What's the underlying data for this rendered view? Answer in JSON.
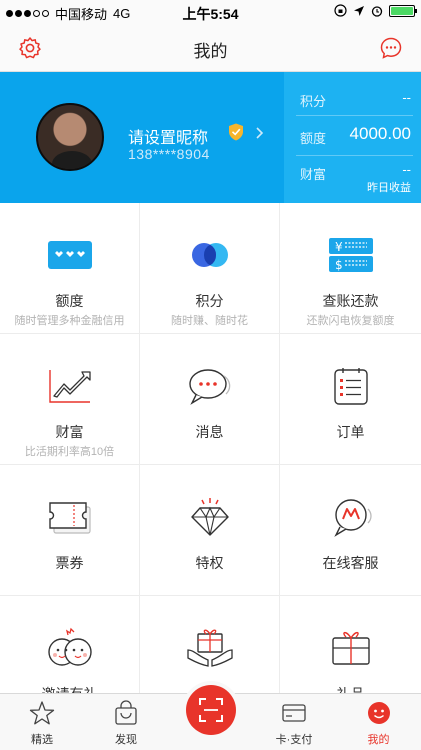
{
  "status_bar": {
    "carrier": "中国移动",
    "network": "4G",
    "time": "上午5:54"
  },
  "nav": {
    "title": "我的"
  },
  "profile": {
    "nickname": "请设置昵称",
    "phone": "138****8904",
    "stats": [
      {
        "label": "积分",
        "value": "--"
      },
      {
        "label": "额度",
        "value": "4000.00"
      },
      {
        "label": "财富",
        "value": "--"
      }
    ],
    "wealth_sub": "昨日收益"
  },
  "grid": [
    {
      "title": "额度",
      "subtitle": "随时管理多种金融信用",
      "icon": "credit-card-icon"
    },
    {
      "title": "积分",
      "subtitle": "随时赚、随时花",
      "icon": "points-icon"
    },
    {
      "title": "查账还款",
      "subtitle": "还款闪电恢复额度",
      "icon": "bill-icon"
    },
    {
      "title": "财富",
      "subtitle": "比活期利率高10倍",
      "icon": "wealth-chart-icon"
    },
    {
      "title": "消息",
      "subtitle": "",
      "icon": "message-icon"
    },
    {
      "title": "订单",
      "subtitle": "",
      "icon": "order-icon"
    },
    {
      "title": "票券",
      "subtitle": "",
      "icon": "ticket-icon"
    },
    {
      "title": "特权",
      "subtitle": "",
      "icon": "diamond-icon"
    },
    {
      "title": "在线客服",
      "subtitle": "",
      "icon": "customer-service-icon"
    },
    {
      "title": "邀请有礼",
      "subtitle": "",
      "icon": "invite-icon"
    },
    {
      "title": "",
      "subtitle": "",
      "icon": "gift-hands-icon"
    },
    {
      "title": "礼品",
      "subtitle": "",
      "icon": "gift-box-icon"
    }
  ],
  "tabs": [
    {
      "label": "精选",
      "icon": "star-icon"
    },
    {
      "label": "发现",
      "icon": "bag-icon"
    },
    {
      "label": "卡·支付",
      "icon": "card-icon"
    },
    {
      "label": "我的",
      "icon": "me-icon"
    }
  ],
  "colors": {
    "brand_blue": "#0aa4ec",
    "accent_red": "#e8342a"
  }
}
